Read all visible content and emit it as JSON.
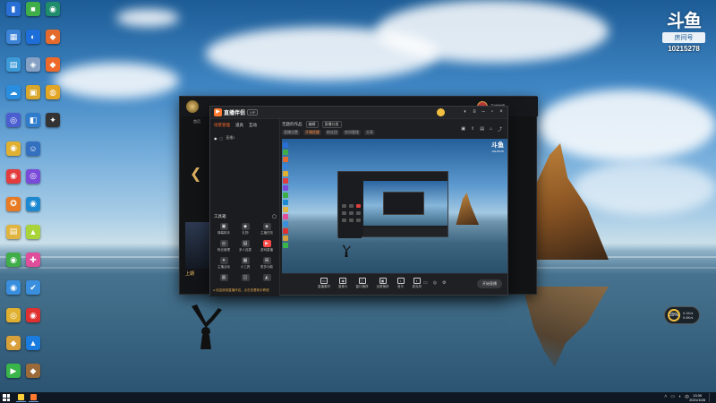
{
  "desktop": {
    "icons": [
      {
        "caption": "",
        "glyph": "▮",
        "color": "#2a6fd6"
      },
      {
        "caption": "",
        "glyph": "■",
        "color": "#3fae49"
      },
      {
        "caption": "",
        "glyph": "◉",
        "color": "#1f8d6b"
      },
      {
        "caption": "",
        "glyph": "▦",
        "color": "#3a83d6"
      },
      {
        "caption": "",
        "glyph": "◐",
        "color": "#1d6ed8"
      },
      {
        "caption": "",
        "glyph": "◆",
        "color": "#e46b2d"
      },
      {
        "caption": "",
        "glyph": "▤",
        "color": "#3d9ad8"
      },
      {
        "caption": "",
        "glyph": "◈",
        "color": "#86a1c4"
      },
      {
        "caption": "",
        "glyph": "◆",
        "color": "#ee6a2a"
      },
      {
        "caption": "",
        "glyph": "☁",
        "color": "#2a8ee0"
      },
      {
        "caption": "",
        "glyph": "▣",
        "color": "#d8a62a"
      },
      {
        "caption": "",
        "glyph": "◍",
        "color": "#e2a524"
      },
      {
        "caption": "",
        "glyph": "◎",
        "color": "#4b5fd1"
      },
      {
        "caption": "",
        "glyph": "◧",
        "color": "#2f7ccc"
      },
      {
        "caption": "",
        "glyph": "✦",
        "color": "#333333"
      },
      {
        "caption": "",
        "glyph": "◉",
        "color": "#e0b030"
      },
      {
        "caption": "",
        "glyph": "☺",
        "color": "#3470c0"
      },
      {
        "caption": "",
        "glyph": "",
        "color": "#1a3b6c"
      },
      {
        "caption": "",
        "glyph": "◉",
        "color": "#e33c3c"
      },
      {
        "caption": "",
        "glyph": "◎",
        "color": "#7a4ad8"
      },
      {
        "caption": "",
        "glyph": "",
        "color": "#1a3b6c"
      },
      {
        "caption": "",
        "glyph": "✪",
        "color": "#e77a23"
      },
      {
        "caption": "",
        "glyph": "◉",
        "color": "#1b88d0"
      },
      {
        "caption": "",
        "glyph": "",
        "color": "#1a3b6c"
      },
      {
        "caption": "",
        "glyph": "▤",
        "color": "#e0b440"
      },
      {
        "caption": "",
        "glyph": "▲",
        "color": "#a8d43a"
      },
      {
        "caption": "",
        "glyph": "",
        "color": "#1a3b6c"
      },
      {
        "caption": "",
        "glyph": "◉",
        "color": "#3fae49"
      },
      {
        "caption": "",
        "glyph": "✚",
        "color": "#e04d9a"
      },
      {
        "caption": "",
        "glyph": "",
        "color": "#1a3b6c"
      },
      {
        "caption": "",
        "glyph": "◉",
        "color": "#3a8ede"
      },
      {
        "caption": "",
        "glyph": "✔",
        "color": "#3a8ede"
      },
      {
        "caption": "",
        "glyph": "",
        "color": "#1a3b6c"
      },
      {
        "caption": "",
        "glyph": "◎",
        "color": "#e0b030"
      },
      {
        "caption": "",
        "glyph": "◉",
        "color": "#e03030"
      },
      {
        "caption": "",
        "glyph": "",
        "color": "#1a3b6c"
      },
      {
        "caption": "",
        "glyph": "◆",
        "color": "#d8a03a"
      },
      {
        "caption": "",
        "glyph": "▲",
        "color": "#1b7ce0"
      },
      {
        "caption": "",
        "glyph": "",
        "color": "#1a3b6c"
      },
      {
        "caption": "",
        "glyph": "▶",
        "color": "#3ab54a"
      },
      {
        "caption": "",
        "glyph": "◆",
        "color": "#9a6a3a"
      }
    ],
    "watermark": {
      "logo": "斗鱼",
      "badge": "房间号",
      "room_id": "10215278"
    }
  },
  "outer_client": {
    "nav_text": "首页",
    "footer_tag": "上期",
    "user_name": "英雄联盟"
  },
  "app": {
    "brand": "直播伴侣",
    "version": "VIP",
    "tabs": [
      {
        "label": "场景管理",
        "active": true
      },
      {
        "label": "道具",
        "active": false
      },
      {
        "label": "互动",
        "active": false
      }
    ],
    "scene_label": "直播1",
    "toolbox_title": "工具箱",
    "tools": [
      {
        "label": "弹幕助手",
        "glyph": "▣",
        "hot": false
      },
      {
        "label": "礼物",
        "glyph": "◆",
        "hot": false
      },
      {
        "label": "主播任务",
        "glyph": "◈",
        "hot": false
      },
      {
        "label": "粉丝管理",
        "glyph": "◎",
        "hot": false
      },
      {
        "label": "多人连麦",
        "glyph": "▤",
        "hot": false
      },
      {
        "label": "游戏直播",
        "glyph": "▶",
        "hot": true
      },
      {
        "label": "主播活动",
        "glyph": "✦",
        "hot": false
      },
      {
        "label": "小工具",
        "glyph": "▦",
        "hot": false
      },
      {
        "label": "更多功能",
        "glyph": "⊞",
        "hot": false
      },
      {
        "label": "",
        "glyph": "▥",
        "hot": false
      },
      {
        "label": "",
        "glyph": "◫",
        "hot": false
      },
      {
        "label": "",
        "glyph": "◭",
        "hot": false
      }
    ],
    "footer_notice": "● 欢迎使用直播伴侣，点击查看新手教程",
    "header": {
      "title": "无题的作品",
      "pill1": "编辑",
      "pill2": "直播分类",
      "tags": [
        "直播设置",
        "开播提醒",
        "粉丝团",
        "房间管理",
        "分享"
      ]
    },
    "preview_mark": {
      "logo": "斗鱼",
      "sub": "10215278"
    },
    "bottom_items": [
      {
        "label": "直播素材",
        "glyph": "▭"
      },
      {
        "label": "摄像头",
        "glyph": "◉"
      },
      {
        "label": "窗口捕获",
        "glyph": "▢"
      },
      {
        "label": "全屏捕获",
        "glyph": "▣"
      },
      {
        "label": "音乐",
        "glyph": "♪"
      },
      {
        "label": "麦克风",
        "glyph": "◖"
      }
    ],
    "bottom_small": [
      "▭",
      "◎",
      "⚙"
    ],
    "start_label": "开始直播"
  },
  "float_widget": {
    "percent": "39%",
    "up": "0.1K/s",
    "down": "0.6K/s"
  },
  "taskbar": {
    "time": "13:30",
    "date": "2021/10/8"
  }
}
